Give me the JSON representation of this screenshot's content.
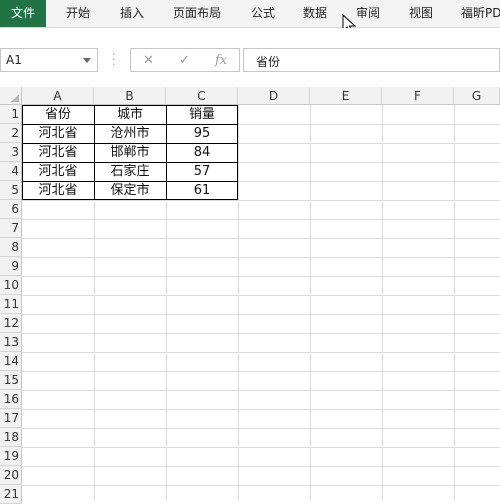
{
  "ribbon": {
    "tabs": [
      "文件",
      "开始",
      "插入",
      "页面布局",
      "公式",
      "数据",
      "审阅",
      "视图",
      "福昕PD"
    ]
  },
  "formula_bar": {
    "name_box": "A1",
    "content": "省份"
  },
  "columns": [
    "A",
    "B",
    "C",
    "D",
    "E",
    "F",
    "G"
  ],
  "rows": [
    "1",
    "2",
    "3",
    "4",
    "5",
    "6",
    "7",
    "8",
    "9",
    "10",
    "11",
    "12",
    "13",
    "14",
    "15",
    "16",
    "17",
    "18",
    "19",
    "20",
    "21"
  ],
  "table": {
    "header": [
      "省份",
      "城市",
      "销量"
    ],
    "rows": [
      [
        "河北省",
        "沧州市",
        "95"
      ],
      [
        "河北省",
        "邯郸市",
        "84"
      ],
      [
        "河北省",
        "石家庄",
        "57"
      ],
      [
        "河北省",
        "保定市",
        "61"
      ]
    ]
  }
}
